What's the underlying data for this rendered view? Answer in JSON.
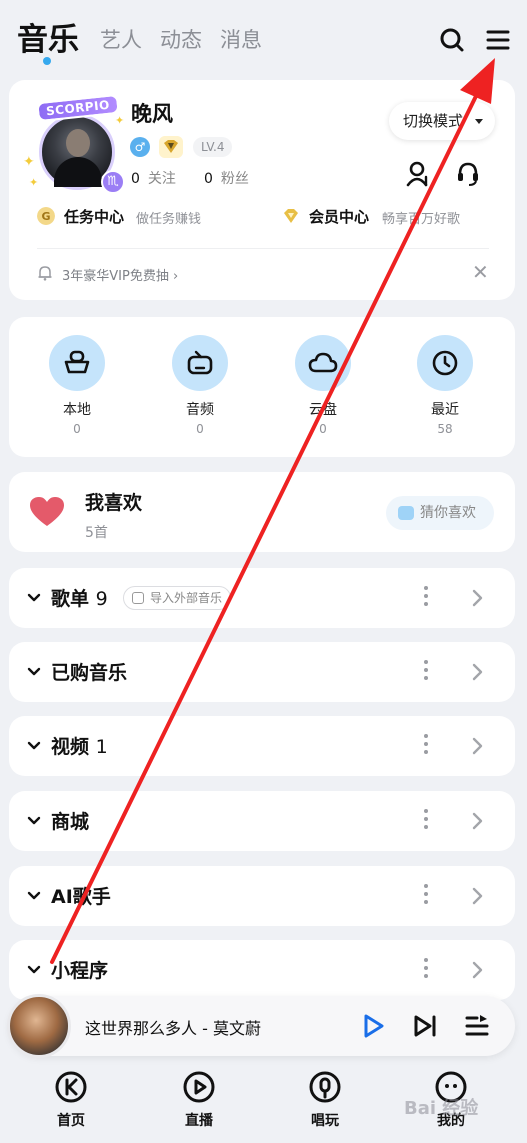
{
  "header": {
    "tabs": [
      {
        "label": "音乐",
        "active": true
      },
      {
        "label": "艺人",
        "active": false
      },
      {
        "label": "动态",
        "active": false
      },
      {
        "label": "消息",
        "active": false
      }
    ],
    "icons": [
      "search-icon",
      "menu-icon"
    ]
  },
  "profile": {
    "badge_text": "SCORPIO",
    "username": "晚风",
    "level": "LV.4",
    "following_count": "0",
    "following_label": "关注",
    "followers_count": "0",
    "followers_label": "粉丝",
    "switch_mode_label": "切换模式",
    "task_center_label": "任务中心",
    "task_center_sub": "做任务赚钱",
    "vip_center_label": "会员中心",
    "vip_center_sub": "畅享百万好歌",
    "notice_text": "3年豪华VIP免费抽 ›"
  },
  "quick_access": [
    {
      "label": "本地",
      "count": "0",
      "icon": "box-icon"
    },
    {
      "label": "音频",
      "count": "0",
      "icon": "radio-icon"
    },
    {
      "label": "云盘",
      "count": "0",
      "icon": "cloud-icon"
    },
    {
      "label": "最近",
      "count": "58",
      "icon": "clock-icon"
    }
  ],
  "favorites": {
    "title": "我喜欢",
    "count": "5首",
    "guess_label": "猜你喜欢"
  },
  "sections": [
    {
      "title": "歌单",
      "count": "9",
      "chip": "导入外部音乐"
    },
    {
      "title": "已购音乐",
      "count": ""
    },
    {
      "title": "视频",
      "count": "1"
    },
    {
      "title": "商城",
      "count": ""
    },
    {
      "title": "AI歌手",
      "count": ""
    },
    {
      "title": "小程序",
      "count": ""
    }
  ],
  "player": {
    "title": "这世界那么多人  -  莫文蔚"
  },
  "bottom_nav": [
    {
      "label": "首页",
      "icon": "home-k-icon"
    },
    {
      "label": "直播",
      "icon": "live-icon"
    },
    {
      "label": "唱玩",
      "icon": "sing-icon"
    },
    {
      "label": "我的",
      "icon": "profile-icon"
    }
  ],
  "watermark": "Bai 经验",
  "colors": {
    "accent_blue": "#36a9ee",
    "icon_circle": "#c5e4fb",
    "heart": "#e45a6a",
    "annotation_red": "#ee2222",
    "background": "#eff1f5"
  }
}
